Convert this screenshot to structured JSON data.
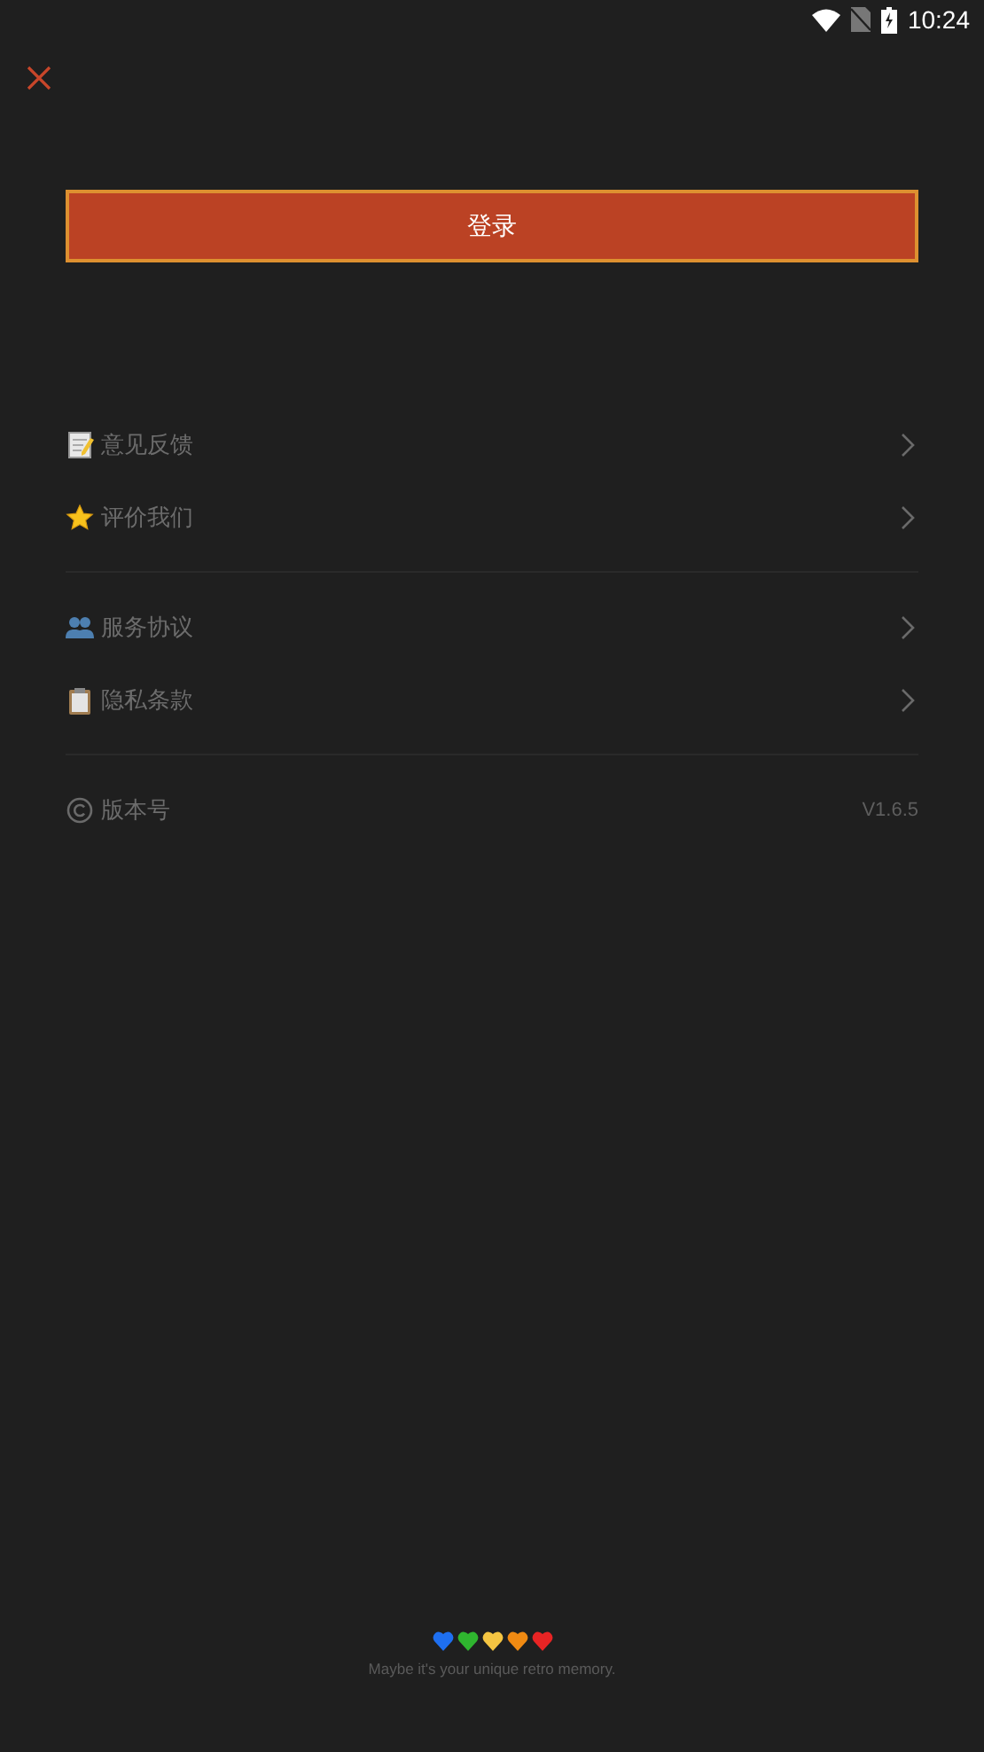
{
  "status_bar": {
    "time": "10:24"
  },
  "login_button": "登录",
  "sections": [
    {
      "items": [
        {
          "label": "意见反馈",
          "kind": "link"
        },
        {
          "label": "评价我们",
          "kind": "link"
        }
      ]
    },
    {
      "items": [
        {
          "label": "服务协议",
          "kind": "link"
        },
        {
          "label": "隐私条款",
          "kind": "link"
        }
      ]
    },
    {
      "items": [
        {
          "label": "版本号",
          "kind": "value",
          "value": "V1.6.5"
        }
      ]
    }
  ],
  "footer": {
    "hearts": [
      {
        "color": "#1e6ff0"
      },
      {
        "color": "#2fb52f"
      },
      {
        "color": "#f5c542"
      },
      {
        "color": "#f08a12"
      },
      {
        "color": "#e82424"
      }
    ],
    "tagline": "Maybe it's your unique retro memory."
  }
}
